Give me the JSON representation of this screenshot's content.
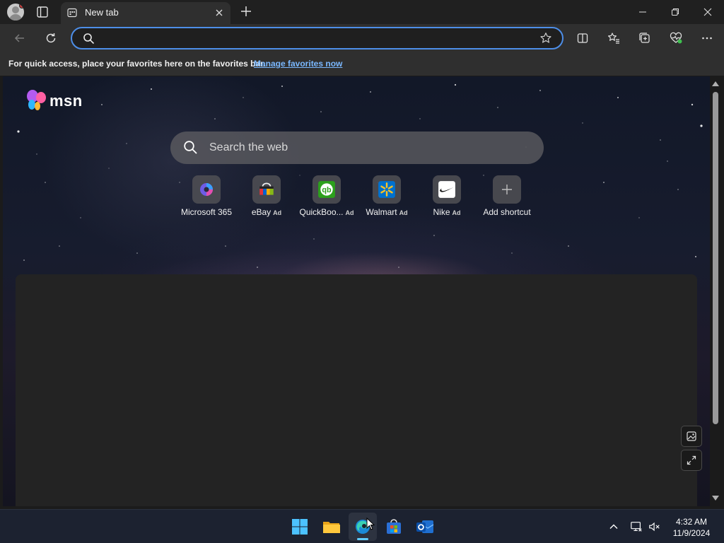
{
  "browser": {
    "tab_title": "New tab",
    "address_value": "",
    "address_placeholder": ""
  },
  "favorites_bar": {
    "message": "For quick access, place your favorites here on the favorites bar.",
    "link": "Manage favorites now"
  },
  "page": {
    "logo": "msn",
    "search_placeholder": "Search the web",
    "shortcuts": [
      {
        "label": "Microsoft 365",
        "ad": "",
        "icon": "microsoft-365-icon"
      },
      {
        "label": "eBay",
        "ad": "Ad",
        "icon": "ebay-icon"
      },
      {
        "label": "QuickBoo...",
        "ad": "Ad",
        "icon": "quickbooks-icon"
      },
      {
        "label": "Walmart",
        "ad": "Ad",
        "icon": "walmart-icon"
      },
      {
        "label": "Nike",
        "ad": "Ad",
        "icon": "nike-icon"
      },
      {
        "label": "Add shortcut",
        "ad": "",
        "icon": "plus-icon"
      }
    ]
  },
  "taskbar": {
    "apps": [
      "start",
      "file-explorer",
      "edge",
      "microsoft-store",
      "outlook"
    ],
    "time": "4:32 AM",
    "date": "11/9/2024"
  },
  "colors": {
    "accent": "#4d8ee8",
    "link": "#7ab8ff",
    "indicator": "#60cdff"
  }
}
